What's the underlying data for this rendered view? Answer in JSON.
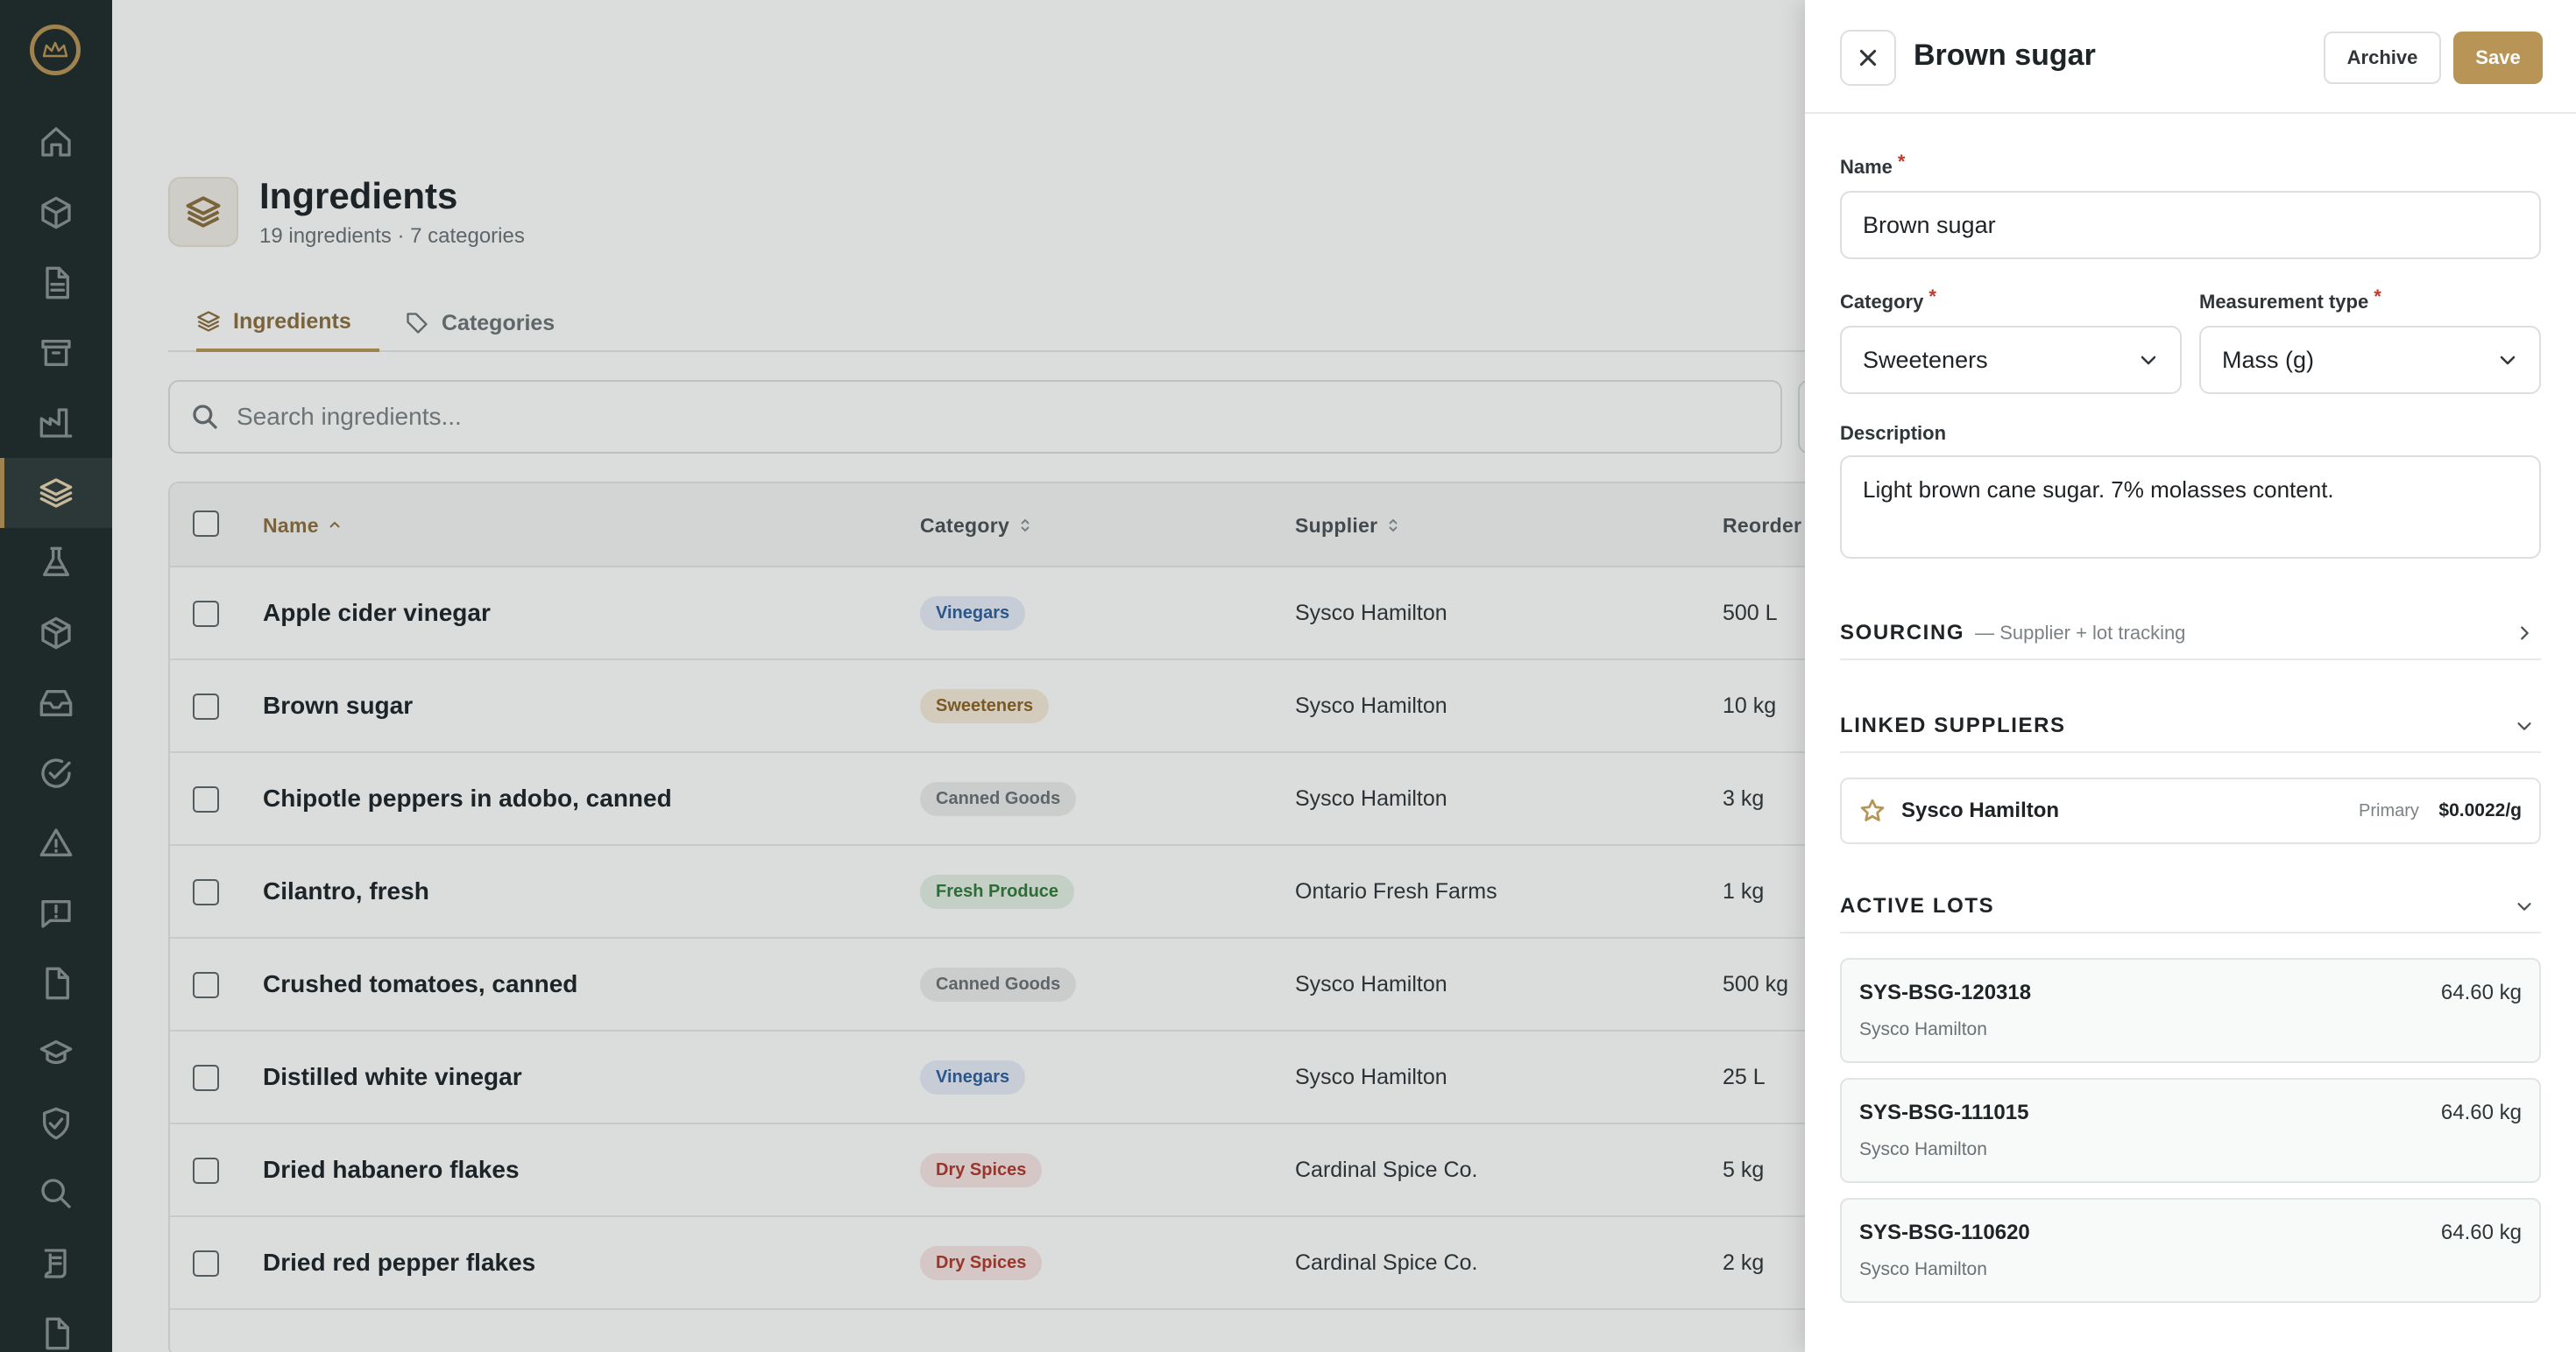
{
  "page": {
    "title": "Ingredients",
    "subtitle": "19 ingredients · 7 categories"
  },
  "tabs": [
    {
      "label": "Ingredients",
      "icon": "layers-icon",
      "active": true
    },
    {
      "label": "Categories",
      "icon": "tag-icon",
      "active": false
    }
  ],
  "search": {
    "placeholder": "Search ingredients..."
  },
  "table": {
    "columns": {
      "name": "Name",
      "category": "Category",
      "supplier": "Supplier",
      "reorder": "Reorder"
    },
    "sort": {
      "column": "Name",
      "direction": "ascending"
    },
    "rows": [
      {
        "name": "Apple cider vinegar",
        "category": "Vinegars",
        "supplier": "Sysco Hamilton",
        "reorder": "500 L"
      },
      {
        "name": "Brown sugar",
        "category": "Sweeteners",
        "supplier": "Sysco Hamilton",
        "reorder": "10 kg"
      },
      {
        "name": "Chipotle peppers in adobo, canned",
        "category": "Canned Goods",
        "supplier": "Sysco Hamilton",
        "reorder": "3 kg"
      },
      {
        "name": "Cilantro, fresh",
        "category": "Fresh Produce",
        "supplier": "Ontario Fresh Farms",
        "reorder": "1 kg"
      },
      {
        "name": "Crushed tomatoes, canned",
        "category": "Canned Goods",
        "supplier": "Sysco Hamilton",
        "reorder": "500 kg"
      },
      {
        "name": "Distilled white vinegar",
        "category": "Vinegars",
        "supplier": "Sysco Hamilton",
        "reorder": "25 L"
      },
      {
        "name": "Dried habanero flakes",
        "category": "Dry Spices",
        "supplier": "Cardinal Spice Co.",
        "reorder": "5 kg"
      },
      {
        "name": "Dried red pepper flakes",
        "category": "Dry Spices",
        "supplier": "Cardinal Spice Co.",
        "reorder": "2 kg"
      }
    ]
  },
  "category_colors": {
    "Vinegars": {
      "bg": "#e6eef8",
      "fg": "#2f5f9e"
    },
    "Sweeteners": {
      "bg": "#f6ecd9",
      "fg": "#8c6426"
    },
    "Canned Goods": {
      "bg": "#eceeee",
      "fg": "#6b7275"
    },
    "Fresh Produce": {
      "bg": "#e4f1e4",
      "fg": "#2f7a3a"
    },
    "Dry Spices": {
      "bg": "#f8e6e4",
      "fg": "#b03a2e"
    }
  },
  "sidebar": {
    "items": [
      {
        "icon": "home-icon"
      },
      {
        "icon": "box-icon"
      },
      {
        "icon": "document-icon"
      },
      {
        "icon": "archive-icon"
      },
      {
        "icon": "factory-icon"
      },
      {
        "icon": "layers-icon",
        "active": true
      },
      {
        "icon": "flask-icon"
      },
      {
        "icon": "package-icon"
      },
      {
        "icon": "inbox-icon"
      },
      {
        "icon": "check-circle-icon"
      },
      {
        "icon": "warning-icon"
      },
      {
        "icon": "message-alert-icon"
      },
      {
        "icon": "file-icon"
      },
      {
        "icon": "graduation-icon"
      },
      {
        "icon": "shield-check-icon"
      },
      {
        "icon": "search-icon"
      },
      {
        "icon": "scroll-icon"
      },
      {
        "icon": "file-icon"
      }
    ]
  },
  "drawer": {
    "title": "Brown sugar",
    "archive_label": "Archive",
    "save_label": "Save",
    "fields": {
      "name_label": "Name",
      "name_value": "Brown sugar",
      "category_label": "Category",
      "category_value": "Sweeteners",
      "measurement_label": "Measurement type",
      "measurement_value": "Mass (g)",
      "description_label": "Description",
      "description_value": "Light brown cane sugar. 7% molasses content.",
      "required_mark": "*"
    },
    "sourcing": {
      "title": "SOURCING",
      "subtitle": "— Supplier + lot tracking"
    },
    "linked_suppliers": {
      "title": "LINKED SUPPLIERS",
      "items": [
        {
          "name": "Sysco Hamilton",
          "tag": "Primary",
          "price": "$0.0022/g"
        }
      ]
    },
    "active_lots": {
      "title": "ACTIVE LOTS",
      "items": [
        {
          "code": "SYS-BSG-120318",
          "supplier": "Sysco Hamilton",
          "qty": "64.60 kg"
        },
        {
          "code": "SYS-BSG-111015",
          "supplier": "Sysco Hamilton",
          "qty": "64.60 kg"
        },
        {
          "code": "SYS-BSG-110620",
          "supplier": "Sysco Hamilton",
          "qty": "64.60 kg"
        }
      ]
    }
  },
  "colors": {
    "accent": "#b89456",
    "sidebar_bg": "#1e2b2b",
    "required": "#c0392b"
  }
}
